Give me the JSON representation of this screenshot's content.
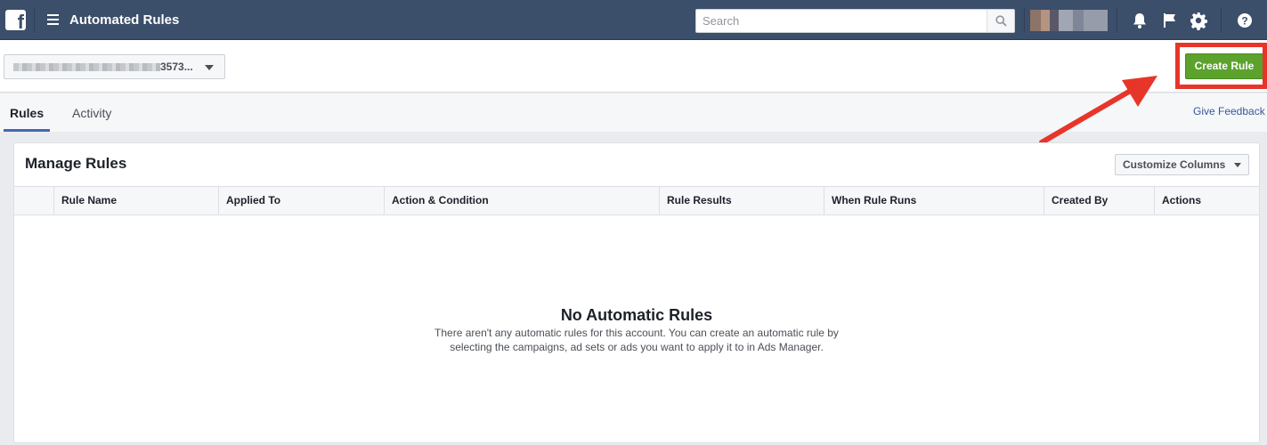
{
  "topbar": {
    "app_title": "Automated Rules",
    "search_placeholder": "Search",
    "icons": [
      "facebook-logo",
      "menu-icon",
      "search-icon",
      "bell-icon",
      "flag-icon",
      "gear-icon",
      "help-icon"
    ]
  },
  "account": {
    "selected_suffix": "3573..."
  },
  "actions": {
    "create_rule": "Create Rule"
  },
  "tabs": [
    {
      "label": "Rules",
      "active": true
    },
    {
      "label": "Activity",
      "active": false
    }
  ],
  "give_feedback": "Give Feedback",
  "panel": {
    "title": "Manage Rules",
    "customize_columns": "Customize Columns",
    "columns": [
      "",
      "Rule Name",
      "Applied To",
      "Action & Condition",
      "Rule Results",
      "When Rule Runs",
      "Created By",
      "Actions"
    ],
    "empty_title": "No Automatic Rules",
    "empty_description": "There aren't any automatic rules for this account. You can create an automatic rule by selecting the campaigns, ad sets or ads you want to apply it to in Ads Manager."
  },
  "colors": {
    "topbar": "#3b4e6a",
    "create_button": "#5ca22d",
    "annotation_red": "#e8352a",
    "link": "#365899"
  }
}
